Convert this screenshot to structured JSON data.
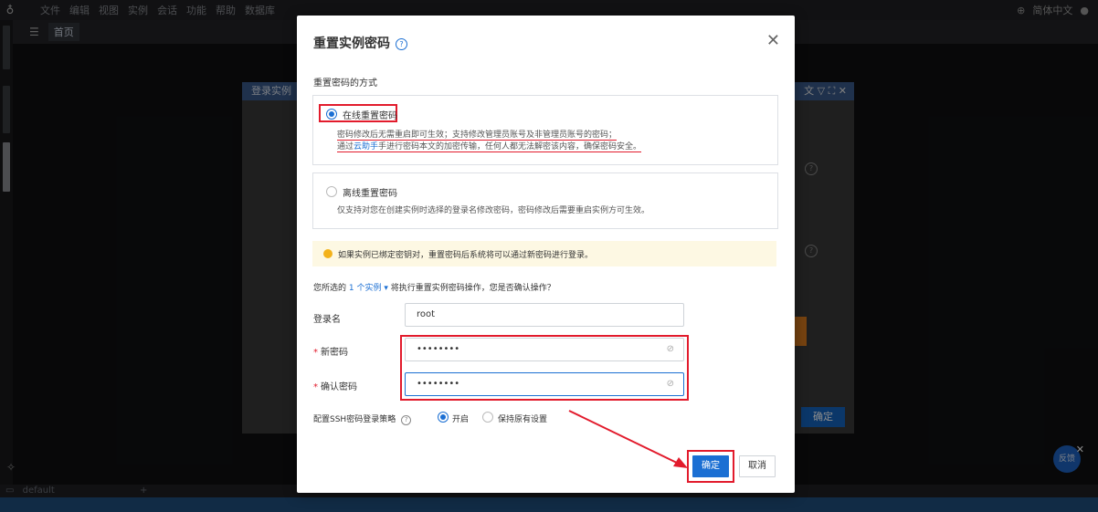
{
  "app": {
    "menu": [
      "文件",
      "编辑",
      "视图",
      "实例",
      "会话",
      "功能",
      "帮助",
      "数据库"
    ],
    "language": "简体中文",
    "tab_home": "首页",
    "session_default": "default",
    "bg_dialog_title": "登录实例",
    "bg_dialog_header_right": "文 ▽ ⛶ ✕",
    "bg_ok": "确定",
    "help_btn": "反馈"
  },
  "modal": {
    "title": "重置实例密码",
    "section_label": "重置密码的方式",
    "online": {
      "label": "在线重置密码",
      "selected": true,
      "desc_line1": "密码修改后无需重启即可生效；支持修改管理员账号及非管理员账号的密码；",
      "desc_line2_a": "通过",
      "desc_line2_link": "云助手",
      "desc_line2_b": "手进行密码本文的加密传输，任何人都无法解密该内容，确保密码安全。"
    },
    "offline": {
      "label": "离线重置密码",
      "selected": false,
      "desc": "仅支持对您在创建实例时选择的登录名修改密码，密码修改后需要重启实例方可生效。"
    },
    "notice": "如果实例已绑定密钥对，重置密码后系统将可以通过新密码进行登录。",
    "confirm": {
      "prefix": "您所选的",
      "count_link": "1 个实例 ▾",
      "suffix": "将执行重置实例密码操作，您是否确认操作？"
    },
    "fields": {
      "login_name_label": "登录名",
      "login_name_value": "root",
      "new_password_label": "新密码",
      "new_password_value": "••••••••",
      "confirm_password_label": "确认密码",
      "confirm_password_value": "••••••••"
    },
    "ssh": {
      "label": "配置SSH密码登录策略",
      "option_on": "开启",
      "option_keep": "保持原有设置",
      "selected": "开启"
    },
    "buttons": {
      "ok": "确定",
      "cancel": "取消"
    }
  },
  "colors": {
    "primary": "#1b6fd3",
    "highlight": "#e21b2c",
    "notice_bg": "#fdf8e3"
  }
}
